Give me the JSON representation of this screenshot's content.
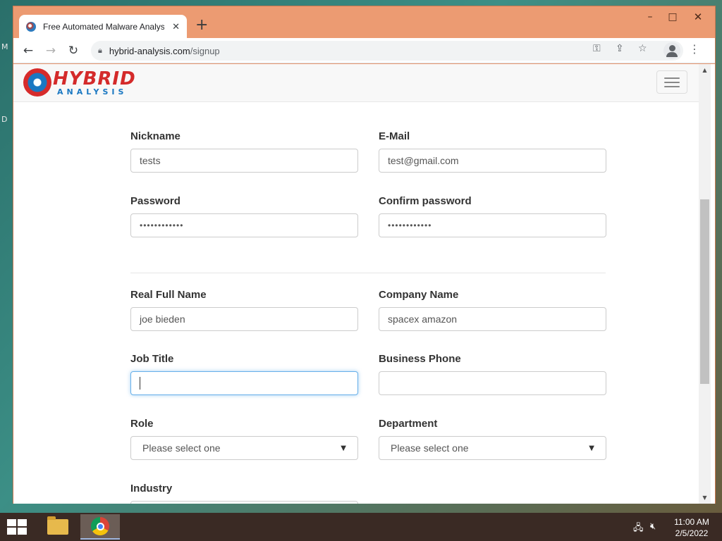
{
  "desktop": {
    "label_m": "M",
    "label_d": "D"
  },
  "browser": {
    "tab_title": "Free Automated Malware Analysis",
    "url_host": "hybrid-analysis.com",
    "url_path": "/signup",
    "window_controls": {
      "minimize": "–",
      "maximize": "□",
      "close": "✕"
    }
  },
  "site": {
    "logo_word1": "HYBRID",
    "logo_word2": "ANALYSIS"
  },
  "form": {
    "nickname": {
      "label": "Nickname",
      "value": "tests"
    },
    "email": {
      "label": "E-Mail",
      "value": "test@gmail.com"
    },
    "password": {
      "label": "Password",
      "value": "••••••••••••"
    },
    "confirm_password": {
      "label": "Confirm password",
      "value": "••••••••••••"
    },
    "full_name": {
      "label": "Real Full Name",
      "value": "joe bieden"
    },
    "company": {
      "label": "Company Name",
      "value": "spacex amazon"
    },
    "job_title": {
      "label": "Job Title",
      "value": ""
    },
    "business_phone": {
      "label": "Business Phone",
      "value": ""
    },
    "role": {
      "label": "Role",
      "selected": "Please select one"
    },
    "department": {
      "label": "Department",
      "selected": "Please select one"
    },
    "industry": {
      "label": "Industry"
    }
  },
  "taskbar": {
    "time": "11:00 AM",
    "date": "2/5/2022"
  },
  "colors": {
    "titlebar": "#ec9b72",
    "focus_border": "#66afe9",
    "logo_red": "#d42a2a",
    "logo_blue": "#1a78c2"
  }
}
